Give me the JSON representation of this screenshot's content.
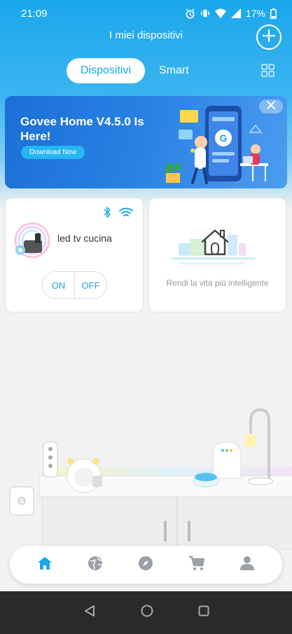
{
  "status": {
    "time": "21:09",
    "battery": "17%"
  },
  "header": {
    "title": "I miei dispositivi"
  },
  "tabs": [
    {
      "label": "Dispositivi",
      "active": true
    },
    {
      "label": "Smart",
      "active": false
    }
  ],
  "banner": {
    "title": "Govee Home V4.5.0 Is Here!",
    "button": "Download Now"
  },
  "device": {
    "name": "led tv cucina",
    "on_label": "ON",
    "off_label": "OFF",
    "connections": [
      "bluetooth-icon",
      "wifi-icon"
    ]
  },
  "add_card": {
    "text": "Rendi la vita più intelligente"
  },
  "bottom_nav": [
    "home-icon",
    "globe-icon",
    "compass-icon",
    "cart-icon",
    "profile-icon"
  ],
  "colors": {
    "accent": "#1aa7ec",
    "banner": "#2a82e4",
    "background": "#f2f2f2"
  }
}
